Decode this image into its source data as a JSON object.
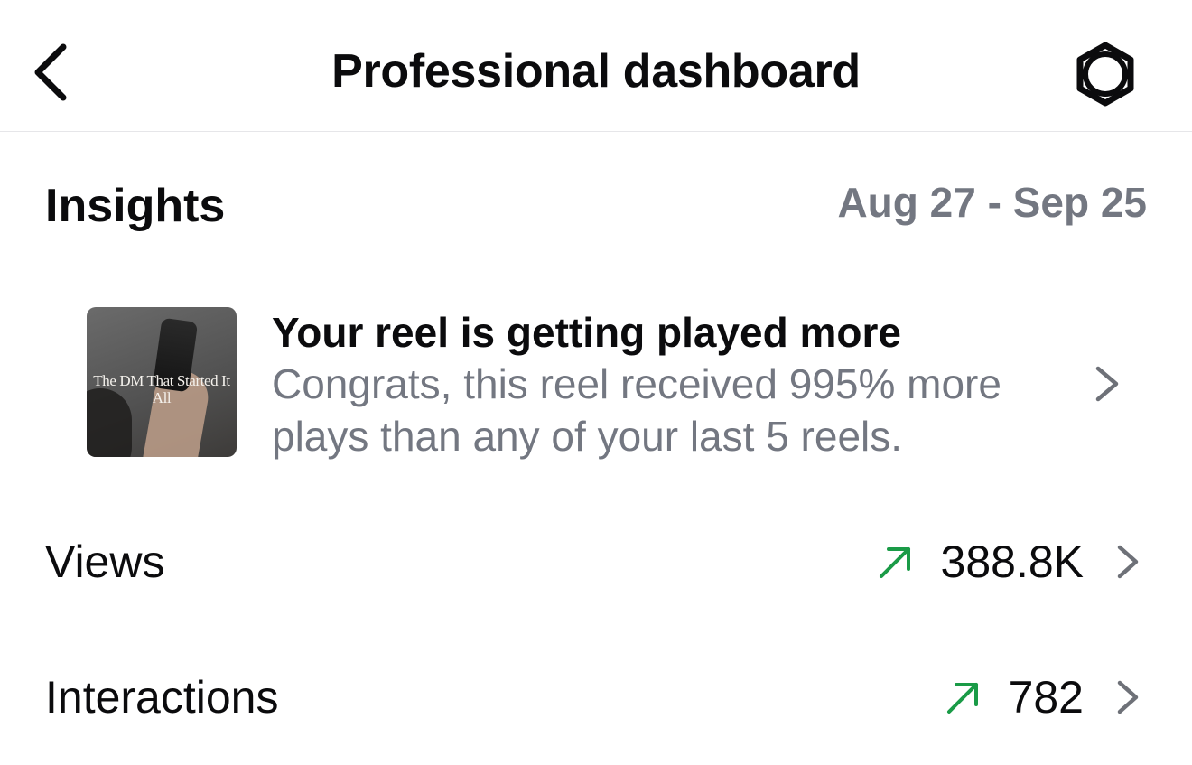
{
  "header": {
    "title": "Professional dashboard",
    "back_icon": "chevron-left-icon",
    "settings_icon": "gear-icon"
  },
  "insights": {
    "title": "Insights",
    "date_range": "Aug 27 - Sep 25"
  },
  "insight_card": {
    "thumbnail_text": "The DM That Started It All",
    "title": "Your reel is getting played more",
    "description": "Congrats, this reel received 995% more plays than any of your last 5 reels."
  },
  "metrics": [
    {
      "label": "Views",
      "value": "388.8K",
      "trend": "up"
    },
    {
      "label": "Interactions",
      "value": "782",
      "trend": "up"
    }
  ],
  "colors": {
    "trend_up": "#1a9b47",
    "secondary_text": "#737781",
    "chevron": "#6e7178"
  }
}
